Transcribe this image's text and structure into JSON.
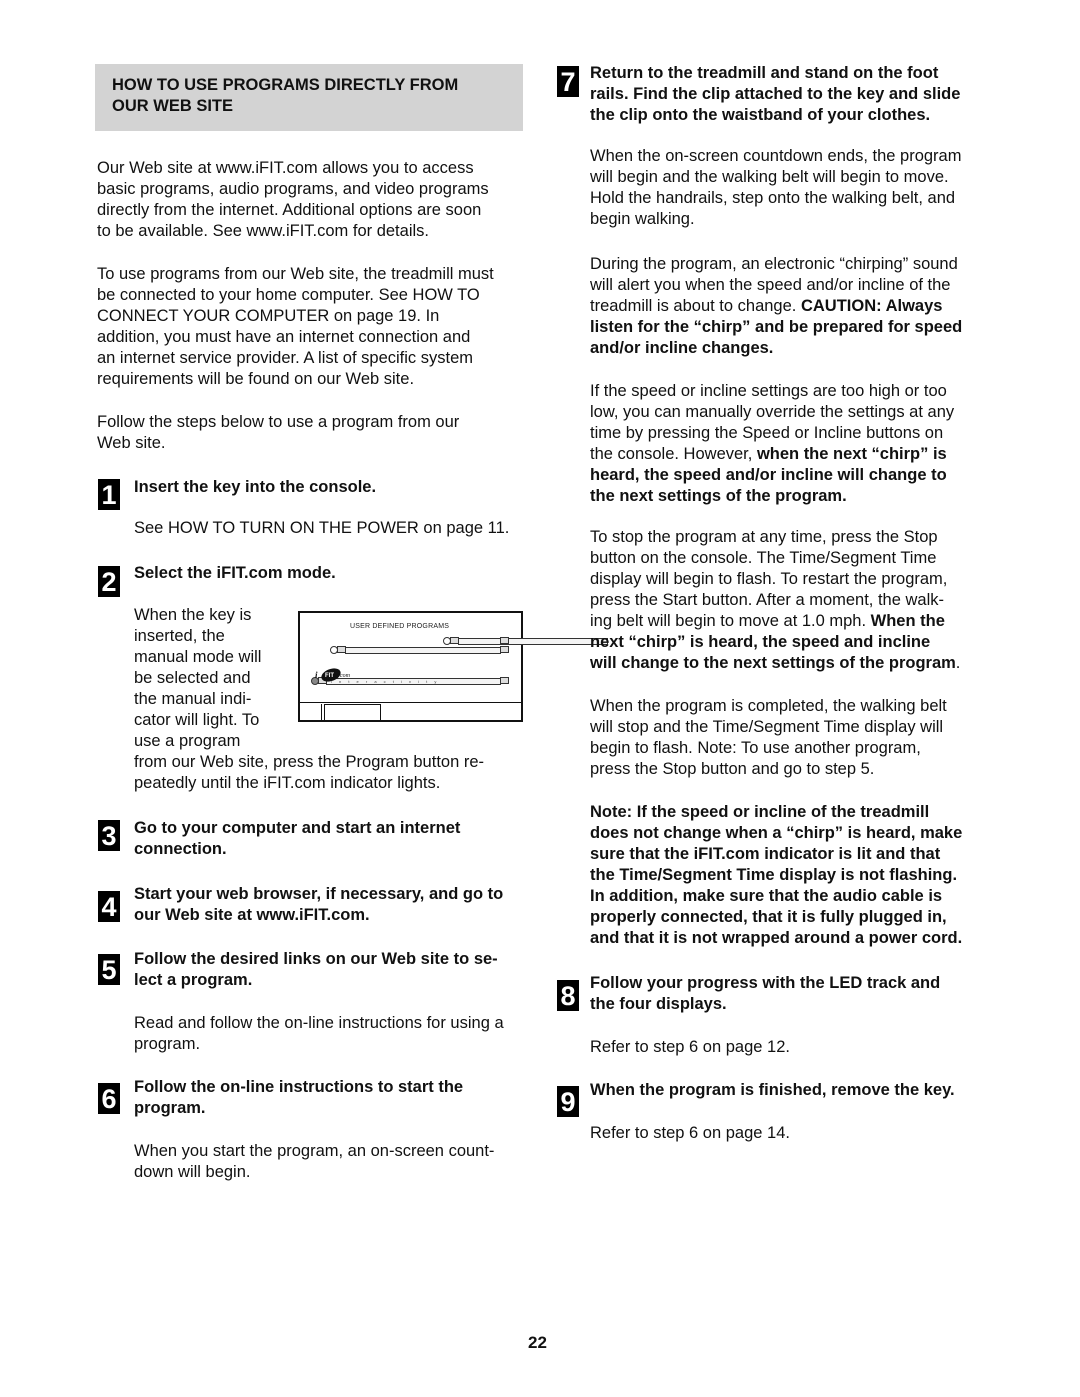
{
  "section": {
    "title_line1": "HOW TO USE PROGRAMS DIRECTLY FROM",
    "title_line2": "OUR WEB SITE"
  },
  "intro": {
    "paragraph1": [
      "Our Web site at www.iFIT.com allows you to access",
      "basic programs, audio programs, and video programs",
      "directly from the internet. Additional options are soon",
      "to be available. See www.iFIT.com for details."
    ],
    "paragraph2": [
      "To use programs from our Web site, the treadmill must",
      "be connected to your home computer. See HOW TO",
      "CONNECT YOUR COMPUTER on page 19. In",
      "addition, you must have an internet connection and",
      "an internet service provider. A list of specific system",
      "requirements will be found on our Web site."
    ],
    "paragraph3": [
      "Follow the steps below to use a program from our",
      "Web site."
    ]
  },
  "steps": [
    {
      "number": "1",
      "title": [
        "Insert the key into the console."
      ],
      "body": [
        "See HOW TO TURN ON THE POWER on page 11."
      ]
    },
    {
      "number": "2",
      "title": [
        "Select the iFIT.com mode."
      ],
      "body_wrapped": [
        "When the key is",
        "inserted, the",
        "manual mode will",
        "be selected and",
        "the manual indi-",
        "cator will light. To",
        "use a program"
      ],
      "body_full": [
        "from our Web site, press the Program button re-",
        "peatedly until the iFIT.com indicator lights."
      ]
    },
    {
      "number": "3",
      "title": [
        "Go to your computer and start an internet",
        "connection."
      ]
    },
    {
      "number": "4",
      "title": [
        "Start your web browser, if necessary, and go to",
        "our Web site at www.iFIT.com."
      ]
    },
    {
      "number": "5",
      "title": [
        "Follow the desired links on our Web site to se-",
        "lect a program."
      ],
      "body": [
        "Read and follow the on-line instructions for using a",
        "program."
      ]
    },
    {
      "number": "6",
      "title": [
        "Follow the on-line instructions to start the",
        "program."
      ],
      "body": [
        "When you start the program, an on-screen count-",
        "down will begin."
      ]
    },
    {
      "number": "7",
      "title": [
        "Return to the treadmill and stand on the foot",
        "rails. Find the clip attached to the key and slide",
        "the clip onto the waistband of your clothes."
      ],
      "body": [
        "When the on-screen countdown ends, the program",
        "will begin and the walking belt will begin to move.",
        "Hold the handrails, step onto the walking belt, and",
        "begin walking."
      ]
    },
    {
      "number": "8",
      "title": [
        "Follow your progress with the LED track and",
        "the four displays."
      ],
      "body": [
        "Refer to step 6 on page 12."
      ]
    },
    {
      "number": "9",
      "title": [
        "When the program is finished, remove the key."
      ],
      "body": [
        "Refer to step 6 on page 14."
      ]
    }
  ],
  "right_column": {
    "chirp": {
      "normal": [
        "During the program, an electronic “chirping” sound",
        "will alert you when the speed and/or incline of the",
        "treadmill is about to change. "
      ],
      "bold": [
        "CAUTION: Always",
        "listen for the “chirp” and be prepared for speed",
        "and/or incline changes."
      ]
    },
    "override": {
      "normal": [
        "If the speed or incline settings are too high or too",
        "low, you can manually override the settings at any",
        "time by pressing the Speed or Incline buttons on",
        "the console. However, "
      ],
      "bold": [
        "when the next “chirp” is",
        "heard, the speed and/or incline will change to",
        "the next settings of the program."
      ]
    },
    "stop": {
      "normal": [
        "To stop the program at any time, press the Stop",
        "button on the console. The Time/Segment Time",
        "display will begin to flash. To restart the program,",
        "press the Start button. After a moment, the walk-",
        "ing belt will begin to move at 1.0 mph. "
      ],
      "bold": [
        "When the",
        "next “chirp” is heard, the speed and incline",
        "will change to the next settings of the program"
      ],
      "tail": "."
    },
    "completed": [
      "When the program is completed, the walking belt",
      "will stop and the Time/Segment Time display will",
      "begin to flash. Note: To use another program,",
      "press the Stop button and go to step 5."
    ],
    "note": [
      "Note: If the speed or incline of the treadmill",
      "does not change when a “chirp” is heard, make",
      "sure that the iFIT.com indicator is lit and that",
      "the Time/Segment Time display is not flashing.",
      "In addition, make sure that the audio cable is",
      "properly connected, that it is fully plugged in,",
      "and that it is not wrapped around a power cord."
    ]
  },
  "console_figure": {
    "caption": "USER DEFINED PROGRAMS",
    "logo_text": "iFIT.com",
    "logo_sub": "i n t e r a c t i v i t y"
  },
  "page_number": "22"
}
